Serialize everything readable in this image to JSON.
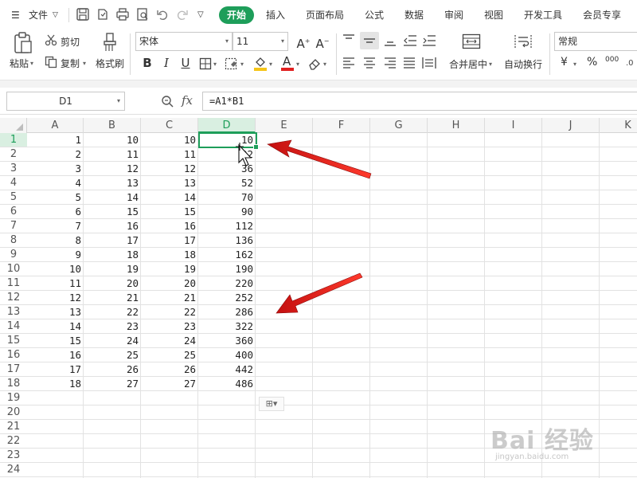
{
  "menu": {
    "file_label": "文件",
    "tabs": [
      "开始",
      "插入",
      "页面布局",
      "公式",
      "数据",
      "审阅",
      "视图",
      "开发工具",
      "会员专享"
    ]
  },
  "ribbon": {
    "paste_label": "粘贴",
    "cut_label": "剪切",
    "copy_label": "复制",
    "format_painter_label": "格式刷",
    "font_name": "宋体",
    "font_size": "11",
    "bold": "B",
    "italic": "I",
    "underline": "U",
    "merge_label": "合并居中",
    "wrap_label": "自动换行",
    "number_format": "常规",
    "currency_symbol": "¥",
    "percent_symbol": "%",
    "thousands_symbol": "000",
    "font_color": "#e02020",
    "fill_color": "#f5c518",
    "accent_color": "#1e9e5a"
  },
  "formula_bar": {
    "cell_ref": "D1",
    "fx_label": "fx",
    "formula": "=A1*B1"
  },
  "sheet": {
    "columns": [
      "A",
      "B",
      "C",
      "D",
      "E",
      "F",
      "G",
      "H",
      "I",
      "J",
      "K"
    ],
    "active_column": "D",
    "active_row": "1",
    "rows": [
      {
        "n": "1",
        "a": "1",
        "b": "10",
        "c": "10",
        "d": "10"
      },
      {
        "n": "2",
        "a": "2",
        "b": "11",
        "c": "11",
        "d": "22"
      },
      {
        "n": "3",
        "a": "3",
        "b": "12",
        "c": "12",
        "d": "36"
      },
      {
        "n": "4",
        "a": "4",
        "b": "13",
        "c": "13",
        "d": "52"
      },
      {
        "n": "5",
        "a": "5",
        "b": "14",
        "c": "14",
        "d": "70"
      },
      {
        "n": "6",
        "a": "6",
        "b": "15",
        "c": "15",
        "d": "90"
      },
      {
        "n": "7",
        "a": "7",
        "b": "16",
        "c": "16",
        "d": "112"
      },
      {
        "n": "8",
        "a": "8",
        "b": "17",
        "c": "17",
        "d": "136"
      },
      {
        "n": "9",
        "a": "9",
        "b": "18",
        "c": "18",
        "d": "162"
      },
      {
        "n": "10",
        "a": "10",
        "b": "19",
        "c": "19",
        "d": "190"
      },
      {
        "n": "11",
        "a": "11",
        "b": "20",
        "c": "20",
        "d": "220"
      },
      {
        "n": "12",
        "a": "12",
        "b": "21",
        "c": "21",
        "d": "252"
      },
      {
        "n": "13",
        "a": "13",
        "b": "22",
        "c": "22",
        "d": "286"
      },
      {
        "n": "14",
        "a": "14",
        "b": "23",
        "c": "23",
        "d": "322"
      },
      {
        "n": "15",
        "a": "15",
        "b": "24",
        "c": "24",
        "d": "360"
      },
      {
        "n": "16",
        "a": "16",
        "b": "25",
        "c": "25",
        "d": "400"
      },
      {
        "n": "17",
        "a": "17",
        "b": "26",
        "c": "26",
        "d": "442"
      },
      {
        "n": "18",
        "a": "18",
        "b": "27",
        "c": "27",
        "d": "486"
      },
      {
        "n": "19",
        "a": "",
        "b": "",
        "c": "",
        "d": ""
      },
      {
        "n": "20",
        "a": "",
        "b": "",
        "c": "",
        "d": ""
      },
      {
        "n": "21",
        "a": "",
        "b": "",
        "c": "",
        "d": ""
      },
      {
        "n": "22",
        "a": "",
        "b": "",
        "c": "",
        "d": ""
      },
      {
        "n": "23",
        "a": "",
        "b": "",
        "c": "",
        "d": ""
      },
      {
        "n": "24",
        "a": "",
        "b": "",
        "c": "",
        "d": ""
      }
    ]
  },
  "annotation": {
    "arrow_color": "#e8261c"
  },
  "watermark": {
    "text": "Bai 经验",
    "sub": "jingyan.baidu.com"
  }
}
